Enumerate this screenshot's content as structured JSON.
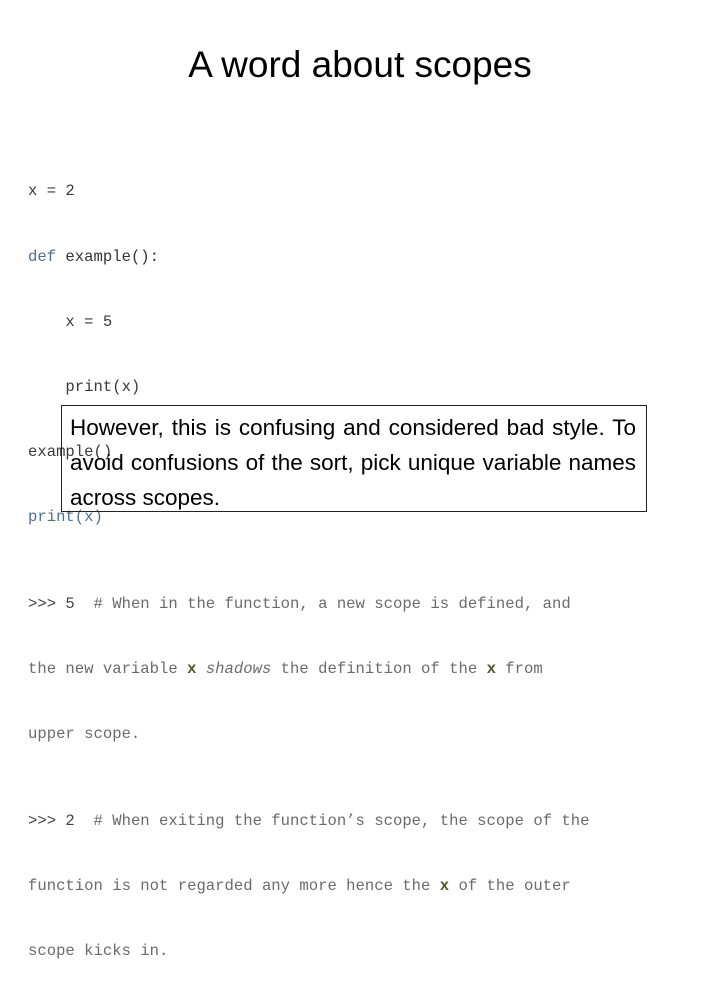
{
  "slide": {
    "title": "A word about scopes",
    "code": {
      "lines": [
        {
          "a": "x = 2"
        },
        {
          "kw": "def",
          "rest": " example():"
        },
        {
          "a": "    x = 5"
        },
        {
          "a": "    print(x)"
        },
        {
          "a": "example()"
        },
        {
          "a": "print(x)"
        }
      ],
      "output1": {
        "prompt": ">>> 5",
        "comment_a": "  # When in the function, a new scope is defined, and",
        "comment_b1": "the new variable ",
        "var": "x",
        "shadows": "shadows",
        "comment_b2": " the definition of the ",
        "comment_b3": " from",
        "comment_c": "upper scope."
      },
      "output2": {
        "prompt": ">>> 2",
        "comment_a": "  # When exiting the function’s scope, the scope of the",
        "comment_b1": "function is not regarded any more hence the ",
        "var": "x",
        "comment_b2": " of the outer",
        "comment_c": "scope kicks in."
      }
    },
    "note": "However, this is confusing and considered bad style. To avoid confusions of the sort, pick unique variable names across scopes."
  }
}
